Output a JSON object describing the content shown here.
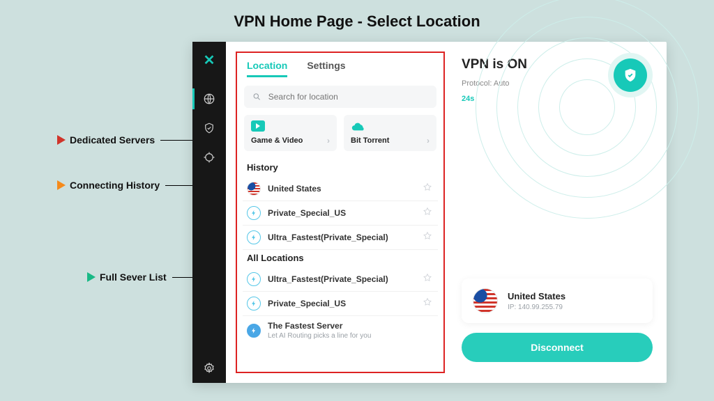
{
  "page_title": "VPN Home Page - Select Location",
  "annotations": {
    "dedicated": "Dedicated Servers",
    "history": "Connecting History",
    "full_list": "Full Sever List"
  },
  "tabs": {
    "location": "Location",
    "settings": "Settings"
  },
  "search": {
    "placeholder": "Search for location"
  },
  "dedicated": {
    "game_video": "Game & Video",
    "bit_torrent": "Bit Torrent"
  },
  "history_section": {
    "title": "History",
    "items": [
      {
        "name": "United States"
      },
      {
        "name": "Private_Special_US"
      },
      {
        "name": "Ultra_Fastest(Private_Special)"
      }
    ]
  },
  "all_section": {
    "title": "All Locations",
    "items": [
      {
        "name": "Ultra_Fastest(Private_Special)"
      },
      {
        "name": "Private_Special_US"
      }
    ]
  },
  "fastest": {
    "name": "The Fastest Server",
    "sub": "Let AI Routing picks a line for you"
  },
  "right": {
    "status": "VPN is ON",
    "protocol": "Protocol: Auto",
    "duration": "24s",
    "conn_country": "United States",
    "conn_ip": "IP: 140.99.255.79",
    "disconnect": "Disconnect"
  }
}
